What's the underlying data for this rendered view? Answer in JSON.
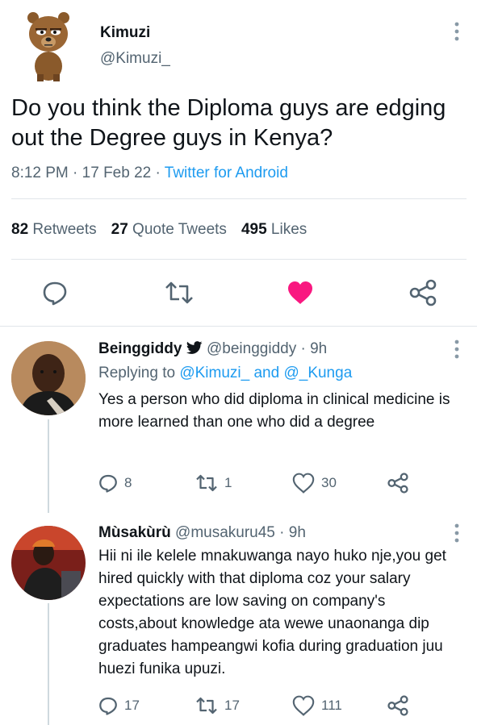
{
  "main_tweet": {
    "author_name": "Kimuzi",
    "author_handle": "@Kimuzi_",
    "text": "Do you think the Diploma guys are edging out the Degree guys in Kenya?",
    "time": "8:12 PM",
    "date": "17 Feb 22",
    "source": "Twitter for Android",
    "retweets": "82",
    "retweets_label": "Retweets",
    "quotes": "27",
    "quotes_label": "Quote Tweets",
    "likes": "495",
    "likes_label": "Likes",
    "like_color": "#f91880"
  },
  "replies": [
    {
      "name": "Beinggiddy",
      "handle": "@beinggiddy",
      "age": "9h",
      "replying_prefix": "Replying to",
      "replying_to": "@Kimuzi_ and @_Kunga",
      "text": "Yes  a person who did diploma in clinical medicine is more learned than one who did a degree",
      "reply_count": "8",
      "retweet_count": "1",
      "like_count": "30",
      "verified_icon": "twitter-bird-icon"
    },
    {
      "name": "Mùsakùrù",
      "handle": "@musakuru45",
      "age": "9h",
      "text": "Hii ni ile kelele mnakuwanga nayo huko nje,you get hired quickly with that diploma coz your salary expectations are low saving on company's costs,about knowledge ata wewe unaonanga dip graduates hampeangwi kofia during graduation juu huezi funika upuzi.",
      "reply_count": "17",
      "retweet_count": "17",
      "like_count": "111"
    }
  ],
  "colors": {
    "text": "#0f1419",
    "secondary": "#536471",
    "link": "#1d9bf0",
    "divider": "#e1e6ea"
  }
}
